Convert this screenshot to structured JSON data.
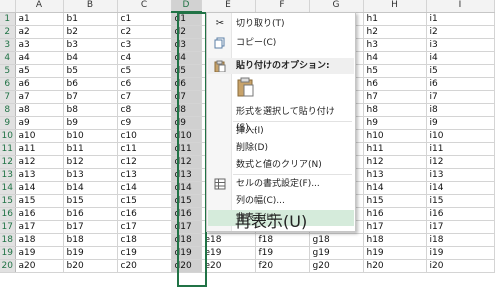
{
  "sheet": {
    "columns": [
      "A",
      "B",
      "C",
      "D",
      "E",
      "F",
      "G",
      "H",
      "I"
    ],
    "rows": [
      {
        "num": "1",
        "cells": [
          "a1",
          "b1",
          "c1",
          "d1",
          "",
          "",
          "",
          "h1",
          "i1"
        ]
      },
      {
        "num": "2",
        "cells": [
          "a2",
          "b2",
          "c2",
          "d2",
          "",
          "",
          "",
          "h2",
          "i2"
        ]
      },
      {
        "num": "3",
        "cells": [
          "a3",
          "b3",
          "c3",
          "d3",
          "",
          "",
          "",
          "h3",
          "i3"
        ]
      },
      {
        "num": "4",
        "cells": [
          "a4",
          "b4",
          "c4",
          "d4",
          "",
          "",
          "",
          "h4",
          "i4"
        ]
      },
      {
        "num": "5",
        "cells": [
          "a5",
          "b5",
          "c5",
          "d5",
          "",
          "",
          "",
          "h5",
          "i5"
        ]
      },
      {
        "num": "6",
        "cells": [
          "a6",
          "b6",
          "c6",
          "d6",
          "",
          "",
          "",
          "h6",
          "i6"
        ]
      },
      {
        "num": "7",
        "cells": [
          "a7",
          "b7",
          "c7",
          "d7",
          "",
          "",
          "",
          "h7",
          "i7"
        ]
      },
      {
        "num": "8",
        "cells": [
          "a8",
          "b8",
          "c8",
          "d8",
          "",
          "",
          "",
          "h8",
          "i8"
        ]
      },
      {
        "num": "9",
        "cells": [
          "a9",
          "b9",
          "c9",
          "d9",
          "",
          "",
          "",
          "h9",
          "i9"
        ]
      },
      {
        "num": "10",
        "cells": [
          "a10",
          "b10",
          "c10",
          "d10",
          "",
          "",
          "",
          "h10",
          "i10"
        ]
      },
      {
        "num": "11",
        "cells": [
          "a11",
          "b11",
          "c11",
          "d11",
          "",
          "",
          "",
          "h11",
          "i11"
        ]
      },
      {
        "num": "12",
        "cells": [
          "a12",
          "b12",
          "c12",
          "d12",
          "",
          "",
          "",
          "h12",
          "i12"
        ]
      },
      {
        "num": "13",
        "cells": [
          "a13",
          "b13",
          "c13",
          "d13",
          "",
          "",
          "",
          "h13",
          "i13"
        ]
      },
      {
        "num": "14",
        "cells": [
          "a14",
          "b14",
          "c14",
          "d14",
          "",
          "",
          "",
          "h14",
          "i14"
        ]
      },
      {
        "num": "15",
        "cells": [
          "a15",
          "b15",
          "c15",
          "d15",
          "",
          "",
          "",
          "h15",
          "i15"
        ]
      },
      {
        "num": "16",
        "cells": [
          "a16",
          "b16",
          "c16",
          "d16",
          "",
          "",
          "",
          "h16",
          "i16"
        ]
      },
      {
        "num": "17",
        "cells": [
          "a17",
          "b17",
          "c17",
          "d17",
          "e17",
          "f17",
          "g17",
          "h17",
          "i17"
        ]
      },
      {
        "num": "18",
        "cells": [
          "a18",
          "b18",
          "c18",
          "d18",
          "e18",
          "f18",
          "g18",
          "h18",
          "i18"
        ]
      },
      {
        "num": "19",
        "cells": [
          "a19",
          "b19",
          "c19",
          "d19",
          "e19",
          "f19",
          "g19",
          "h19",
          "i19"
        ]
      },
      {
        "num": "20",
        "cells": [
          "a20",
          "b20",
          "c20",
          "d20",
          "e20",
          "f20",
          "g20",
          "h20",
          "i20"
        ]
      }
    ]
  },
  "menu": {
    "items": [
      {
        "label": "切り取り(T)",
        "icon": "scissors-icon",
        "glyph": "✂"
      },
      {
        "label": "コピー(C)",
        "icon": "copy-icon",
        "glyph": "⎘"
      },
      {
        "label": "貼り付けのオプション:",
        "icon": "paste-icon",
        "glyph": "📋"
      },
      {
        "label": "形式を選択して貼り付け(S)...",
        "icon": "",
        "glyph": ""
      },
      {
        "label": "挿入(I)",
        "icon": "",
        "glyph": ""
      },
      {
        "label": "削除(D)",
        "icon": "",
        "glyph": ""
      },
      {
        "label": "数式と値のクリア(N)",
        "icon": "",
        "glyph": ""
      },
      {
        "label": "セルの書式設定(F)...",
        "icon": "format-cells-icon",
        "glyph": "☷"
      },
      {
        "label": "列の幅(C)...",
        "icon": "",
        "glyph": ""
      },
      {
        "label": "非表示(H)",
        "icon": "",
        "glyph": ""
      },
      {
        "label": "再表示(U)",
        "icon": "",
        "glyph": ""
      }
    ],
    "hover_index": 9
  },
  "colors": {
    "accent": "#217346",
    "hover": "#d5ebdb",
    "selected_column": "#d0d0d0"
  }
}
